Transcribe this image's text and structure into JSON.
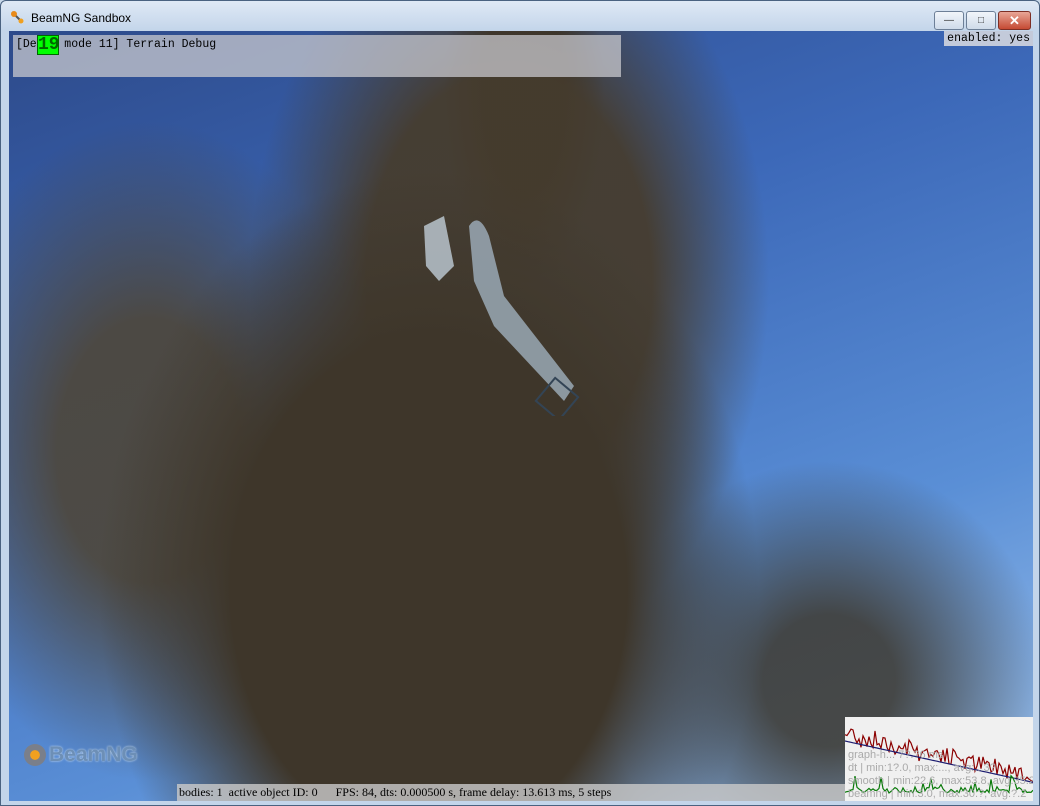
{
  "window": {
    "title": "BeamNG Sandbox",
    "buttons": {
      "minimize": "—",
      "maximize": "□",
      "close": "✕"
    }
  },
  "debug": {
    "text": "[Debug mode 11] Terrain Debug",
    "fps_badge": "19",
    "enabled": "enabled: yes"
  },
  "logo": "BeamNG",
  "status": {
    "text": "bodies: 1  active object ID: 0      FPS: 84, dts: 0.000500 s, frame delay: 13.613 ms, 5 steps"
  },
  "graph": {
    "lines": [
      "graph-h... 7?.?6 ms",
      "dt     | min:1?.0, max:..., avg:...3?",
      "smooth | min:22.6, max:53.8, avg:35.2",
      "beamng | min:3.0, max:30.?, avg:?.2"
    ],
    "colors": {
      "dt": "#8b0000",
      "smooth": "#1a1a6e",
      "beamng": "#0a7a0a"
    }
  }
}
